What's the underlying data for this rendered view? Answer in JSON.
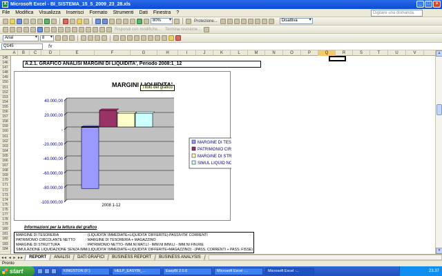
{
  "window": {
    "title": "Microsoft Excel - BI_SISTEMA_15_5_2009_23_28.xls",
    "app_icon": "X"
  },
  "menu": {
    "items": [
      "File",
      "Modifica",
      "Visualizza",
      "Inserisci",
      "Formato",
      "Strumenti",
      "Dati",
      "Finestra",
      "?"
    ],
    "help_placeholder": "Digitare una domanda."
  },
  "toolbar": {
    "zoom": "80%",
    "protection_label": "Protezione...",
    "disabled_combo": "Disattiva",
    "review_label": "Rispondi con modifiche...",
    "end_review_label": "Termina revisione...",
    "font_name": "Arial",
    "font_size": "8"
  },
  "formula": {
    "cell_ref": "Q145",
    "fx": "fx"
  },
  "columns": [
    "A",
    "B",
    "C",
    "D",
    "E",
    "F",
    "G",
    "H",
    "I",
    "J",
    "K",
    "L",
    "M",
    "N",
    "O",
    "P",
    "Q",
    "R",
    "S",
    "T",
    "U",
    "V"
  ],
  "selected_column": "Q",
  "rows": [
    "145",
    "146",
    "147",
    "148",
    "149",
    "150",
    "151",
    "152",
    "153",
    "154",
    "155",
    "156",
    "157",
    "158",
    "159",
    "160",
    "161",
    "162",
    "163",
    "164",
    "165",
    "166",
    "167",
    "168",
    "169",
    "170",
    "171",
    "172",
    "173",
    "174",
    "175",
    "176",
    "177",
    "178",
    "179",
    "180",
    "181",
    "182",
    "183",
    "184"
  ],
  "section_title": "A.2.1. GRAFICO ANALISI MARGINI DI LIQUIDITA', Periodo 2008:1_12",
  "tooltip": "Titolo del grafico",
  "chart_data": {
    "type": "bar",
    "title": "MARGINI LIQUIDITA'",
    "categories": [
      "2008 1-12"
    ],
    "series": [
      {
        "name": "MARGINE DI TESORERIA",
        "values": [
          -85000
        ],
        "color": "#9999ff"
      },
      {
        "name": "PATRIMONIO CIRCOLANTE NETTO",
        "values": [
          23000
        ],
        "color": "#993366"
      },
      {
        "name": "MARGINE DI STRUTTURA",
        "values": [
          19000
        ],
        "color": "#ffffcc"
      },
      {
        "name": "SIMUL LIQUID NO IMM",
        "values": [
          19000
        ],
        "color": "#ccffff"
      }
    ],
    "ylim": [
      -100000,
      40000
    ],
    "yticks": [
      40000,
      20000,
      0,
      -20000,
      -40000,
      -60000,
      -80000,
      -100000
    ],
    "ytick_labels": [
      "40.000,00",
      "20.000,00",
      "-",
      "-20.000,00",
      "-40.000,00",
      "-60.000,00",
      "-80.000,00",
      "-100.000,00"
    ],
    "grid": true,
    "legend": "right",
    "plot_bg": "#c0c0c0",
    "series_line": {
      "values": [
        0
      ],
      "color": "#000000"
    }
  },
  "info": {
    "title": "Informazioni per la lettura del grafico",
    "rows": [
      {
        "label": "MARGINE DI TESORERIA",
        "text": ": (LIQUIDITA' IMMEDIATE+LIQUIDITA' DIFFERITE)-PASSIVITA' CORRENTI"
      },
      {
        "label": "PATRIMONIO CIRCOLANTE NETTO",
        "text": ": MARGINE DI TESORERIA + MAGAZZINO"
      },
      {
        "label": "MARGINE DI STRUTTURA",
        "text": ": PATRIMONIO NETTO- IMM.NI MAT.LI - IMM.NI IMM.LI - IMM.NI FIN.RIE"
      },
      {
        "label": "SIMULAZIONE LIQUIDAZIONE SENZA IMM",
        "text": ": (LIQUIDITA' IMMEDIATE+LIQUIDITA' DIFFERITE+MAGAZZINO) - (PASS. CORRENTI + PASS. FISSE)"
      }
    ]
  },
  "tabs": {
    "nav": "◂◂ ◂ ▸ ▸▸",
    "items": [
      "REPORT",
      "ANALISI",
      "DATI GRAFICI",
      "BUSINESS REPORT",
      "BUSINESS ANALYSIS"
    ],
    "active": "REPORT"
  },
  "status": "Pronto",
  "taskbar": {
    "start": "start",
    "items": [
      "KINGSTON (F:)",
      "HELP_EASYBI_...",
      "EasyBI  2.0.6",
      "Microsoft Excel -...",
      "Microsoft Excel -..."
    ],
    "active_index": 4,
    "clock": "23.37"
  }
}
